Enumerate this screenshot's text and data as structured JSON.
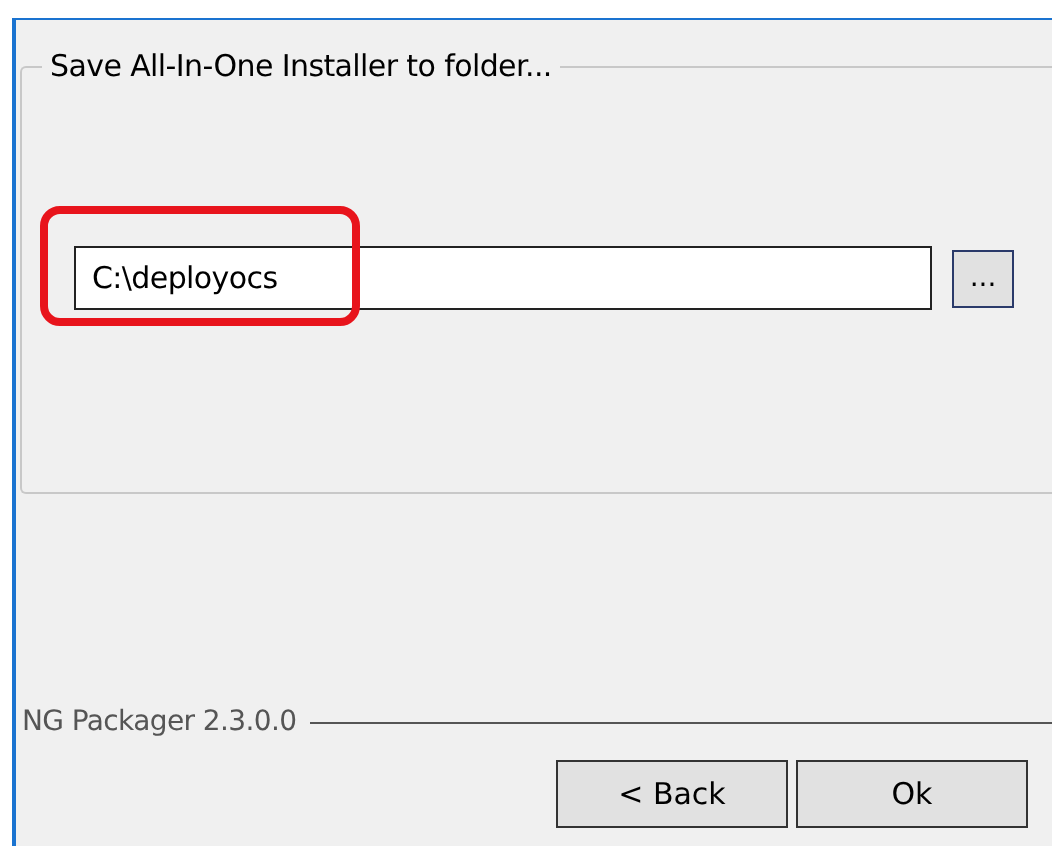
{
  "group": {
    "title": "Save All-In-One Installer to folder..."
  },
  "folder_field": {
    "value": "C:\\deployocs"
  },
  "browse_button": {
    "label": "..."
  },
  "footer": {
    "label": "NG Packager 2.3.0.0"
  },
  "buttons": [
    {
      "label": "< Back"
    },
    {
      "label": "Ok"
    }
  ]
}
